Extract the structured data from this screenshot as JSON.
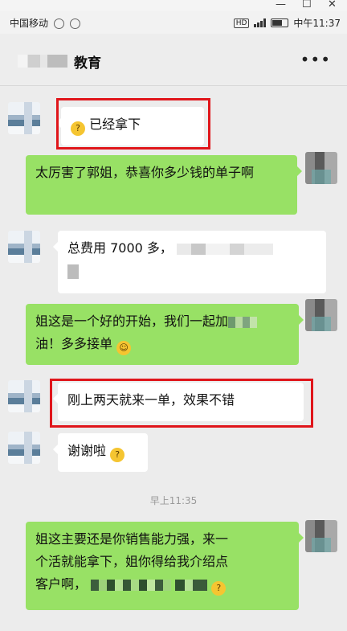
{
  "window_controls": {
    "minimize": "—",
    "maximize": "☐",
    "close": "✕"
  },
  "status_bar": {
    "carrier": "中国移动",
    "time": "中午11:37",
    "hd": "HD"
  },
  "header": {
    "title": "教育",
    "more_icon": "more-dots-icon",
    "more_label": "•••"
  },
  "messages": [
    {
      "side": "left",
      "text": "已经拿下",
      "emoji": "thinking"
    },
    {
      "side": "right",
      "text": "太厉害了郭姐，恭喜你多少钱的单子啊"
    },
    {
      "side": "left",
      "text": "总费用 7000 多，"
    },
    {
      "side": "right",
      "text_a": "姐这是一个好的开始，我们一起加",
      "text_b": "油！多多接单"
    },
    {
      "side": "left",
      "text": "刚上两天就来一单，效果不错"
    },
    {
      "side": "left",
      "text": "谢谢啦"
    },
    {
      "side": "right",
      "text_a": "姐这主要还是你销售能力强，来一",
      "text_b": "个活就能拿下，姐你得给我介绍点",
      "text_c": "客户啊，"
    }
  ],
  "timestamp": "早上11:35",
  "colors": {
    "bubble_green": "#98e165",
    "highlight_red": "#e0161b",
    "background": "#ececec"
  }
}
